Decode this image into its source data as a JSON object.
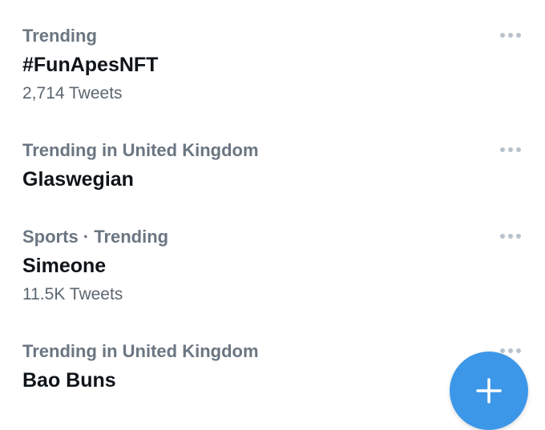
{
  "trends": [
    {
      "context": "Trending",
      "name": "#FunApesNFT",
      "count": "2,714 Tweets"
    },
    {
      "context": "Trending in United Kingdom",
      "name": "Glaswegian",
      "count": ""
    },
    {
      "context": "Sports · Trending",
      "name": "Simeone",
      "count": "11.5K Tweets"
    },
    {
      "context": "Trending in United Kingdom",
      "name": "Bao Buns",
      "count": ""
    }
  ],
  "icons": {
    "more": "more-horizontal-icon",
    "compose": "plus-icon"
  },
  "colors": {
    "context_text": "#6b7682",
    "name_text": "#0f1419",
    "count_text": "#5b6670",
    "dots": "#b9c2ca",
    "fab": "#3d97e8"
  }
}
